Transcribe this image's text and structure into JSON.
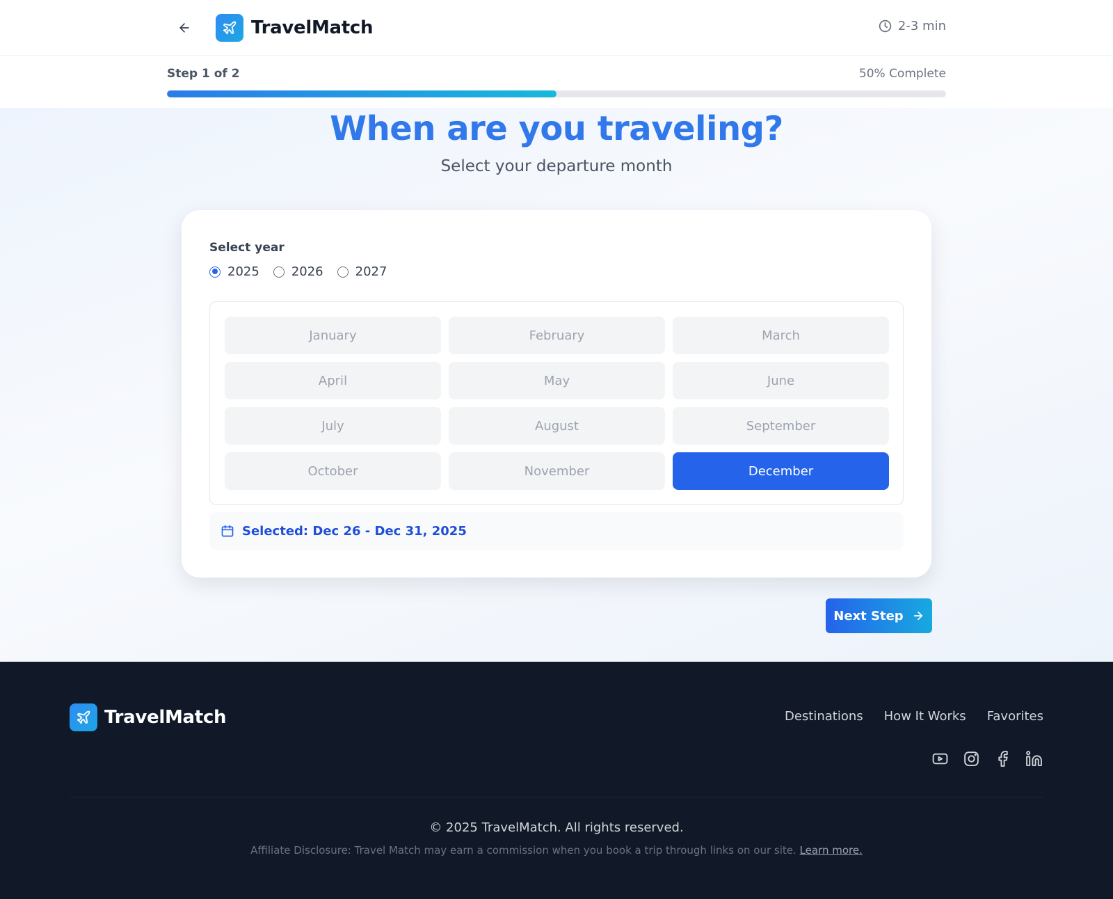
{
  "header": {
    "brand": "TravelMatch",
    "back_icon": "arrow-left-icon",
    "logo_icon": "airplane-icon",
    "time_icon": "clock-icon",
    "time_estimate": "2-3 min"
  },
  "progress": {
    "step_label": "Step 1 of 2",
    "percent_label": "50% Complete",
    "fraction": 0.5
  },
  "main": {
    "title": "When are you traveling?",
    "subtitle": "Select your departure month",
    "year_label": "Select year",
    "years": [
      {
        "label": "2025",
        "selected": true
      },
      {
        "label": "2026",
        "selected": false
      },
      {
        "label": "2027",
        "selected": false
      }
    ],
    "months": [
      "January",
      "February",
      "March",
      "April",
      "May",
      "June",
      "July",
      "August",
      "September",
      "October",
      "November",
      "December"
    ],
    "selected_month": "December",
    "selected_text": "Selected: Dec 26 - Dec 31, 2025",
    "selected_icon": "calendar-icon",
    "next_label": "Next Step",
    "next_icon": "arrow-right-icon"
  },
  "footer": {
    "brand": "TravelMatch",
    "links": [
      "Destinations",
      "How It Works",
      "Favorites"
    ],
    "socials": [
      "youtube-icon",
      "instagram-icon",
      "facebook-icon",
      "linkedin-icon"
    ],
    "copyright": "© 2025 TravelMatch. All rights reserved.",
    "disclosure": "Affiliate Disclosure: Travel Match may earn a commission when you book a trip through links on our site.",
    "learn_more": "Learn more."
  },
  "colors": {
    "accent": "#2563eb",
    "title": "#3178ea",
    "footer_bg": "#111827"
  }
}
